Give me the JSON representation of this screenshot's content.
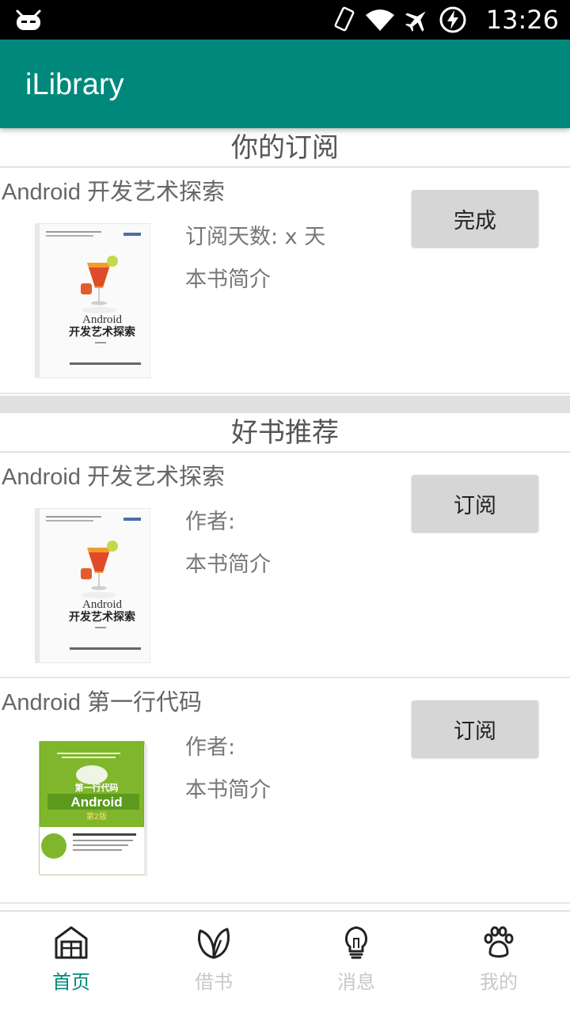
{
  "status_bar": {
    "time": "13:26",
    "icons": [
      "android-robot-icon",
      "vibrate-icon",
      "wifi-icon",
      "airplane-mode-icon",
      "battery-charging-icon"
    ]
  },
  "app_bar": {
    "title": "iLibrary"
  },
  "subscriptions": {
    "header": "你的订阅",
    "items": [
      {
        "title": "Android 开发艺术探索",
        "meta1": "订阅天数: x 天",
        "meta2": "本书简介",
        "button": "完成",
        "cover_lines": {
          "series": "Android",
          "name": "开发艺术探索"
        }
      }
    ]
  },
  "recommend": {
    "header": "好书推荐",
    "items": [
      {
        "title": "Android 开发艺术探索",
        "meta1": "作者:",
        "meta2": "本书简介",
        "button": "订阅",
        "cover_lines": {
          "series": "Android",
          "name": "开发艺术探索"
        }
      },
      {
        "title": "Android 第一行代码",
        "meta1": "作者:",
        "meta2": "本书简介",
        "button": "订阅",
        "cover_lines": {
          "top": "第一行代码",
          "series": "Android",
          "edition": "第2版"
        }
      }
    ]
  },
  "bottom_nav": {
    "items": [
      {
        "label": "首页",
        "icon": "home-icon",
        "active": true
      },
      {
        "label": "借书",
        "icon": "leaf-icon",
        "active": false
      },
      {
        "label": "消息",
        "icon": "lightbulb-icon",
        "active": false
      },
      {
        "label": "我的",
        "icon": "paw-icon",
        "active": false
      }
    ]
  },
  "colors": {
    "primary": "#00897b",
    "inactive": "#c8c8c8",
    "button_bg": "#d6d6d6"
  }
}
